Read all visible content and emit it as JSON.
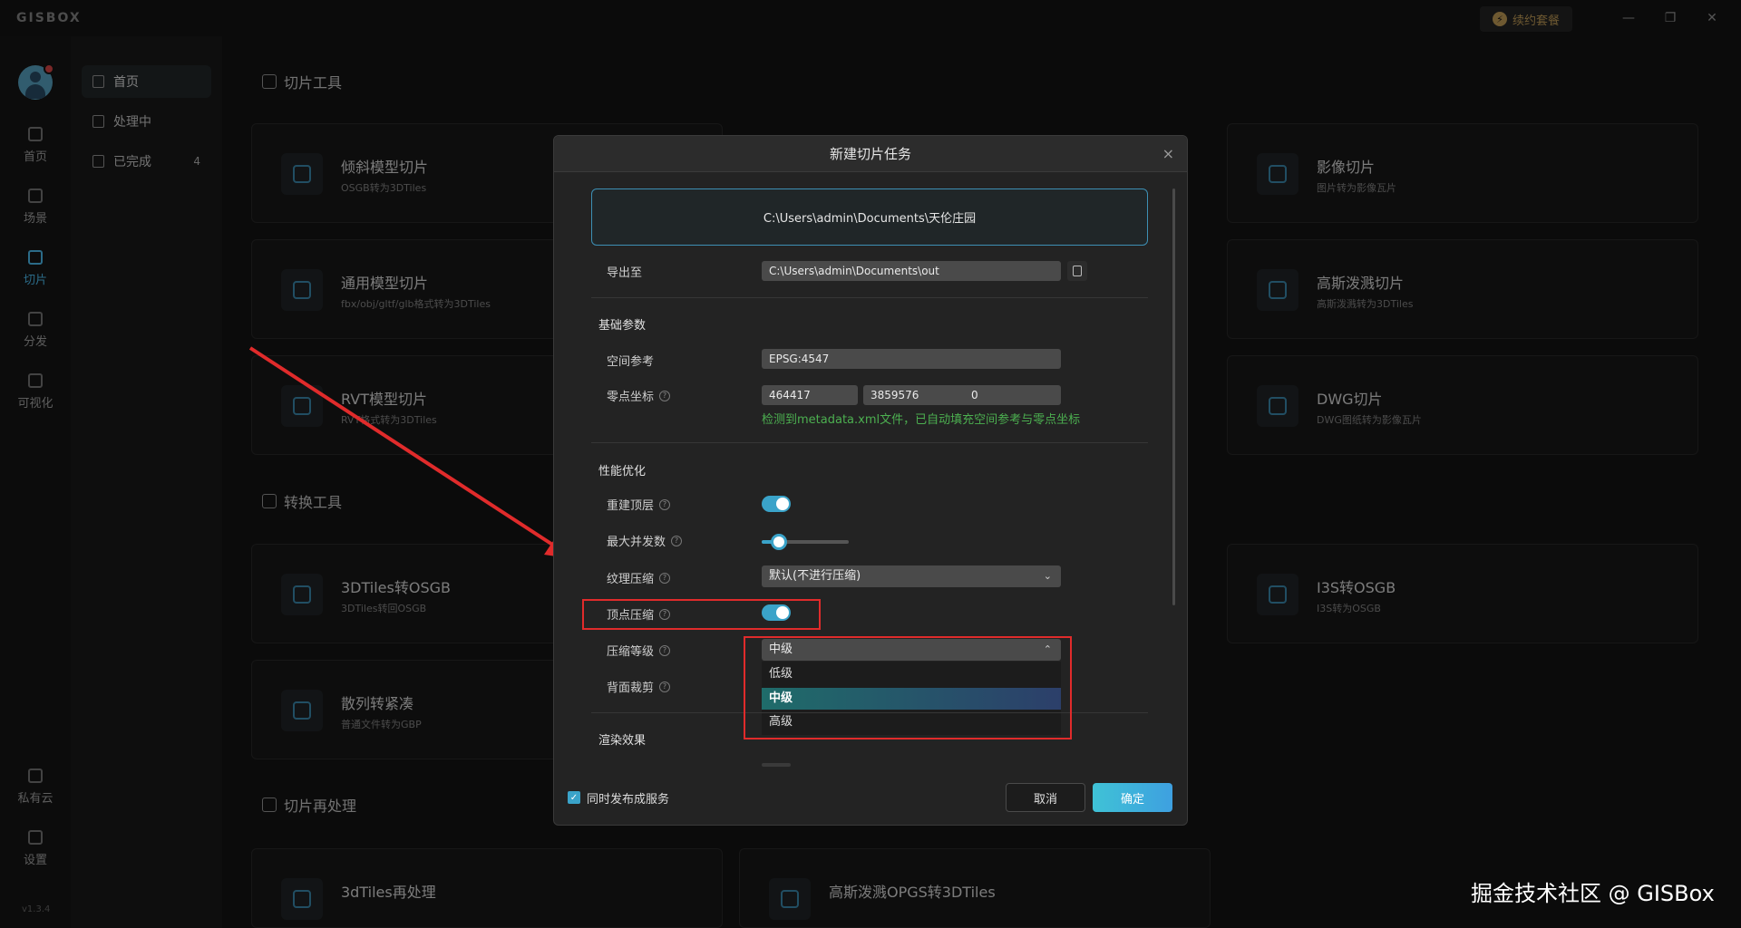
{
  "app": {
    "brand": "GISBOX",
    "version": "v1.3.4",
    "renew_label": "续约套餐"
  },
  "window": {
    "minimize": "—",
    "restore": "❐",
    "close": "✕"
  },
  "rail": {
    "items": [
      {
        "label": "首页",
        "icon": "home-icon"
      },
      {
        "label": "场景",
        "icon": "scene-icon"
      },
      {
        "label": "切片",
        "icon": "slice-icon",
        "active": true
      },
      {
        "label": "分发",
        "icon": "distribute-icon"
      },
      {
        "label": "可视化",
        "icon": "visualize-icon"
      },
      {
        "label": "私有云",
        "icon": "lock-icon"
      },
      {
        "label": "设置",
        "icon": "gear-icon"
      }
    ]
  },
  "nav": {
    "items": [
      {
        "label": "首页",
        "count": ""
      },
      {
        "label": "处理中",
        "count": ""
      },
      {
        "label": "已完成",
        "count": "4"
      }
    ]
  },
  "sections": {
    "slice_tools": "切片工具",
    "convert_tools": "转换工具",
    "reprocess": "切片再处理"
  },
  "cards": [
    {
      "title": "倾斜模型切片",
      "sub": "OSGB转为3DTiles"
    },
    {
      "title": "影像切片",
      "sub": "图片转为影像瓦片"
    },
    {
      "title": "通用模型切片",
      "sub": "fbx/obj/gltf/glb格式转为3DTiles"
    },
    {
      "title": "高斯泼溅切片",
      "sub": "高斯泼溅转为3DTiles"
    },
    {
      "title": "RVT模型切片",
      "sub": "RVT格式转为3DTiles"
    },
    {
      "title": "DWG切片",
      "sub": "DWG图纸转为影像瓦片"
    },
    {
      "title": "3DTiles转OSGB",
      "sub": "3DTiles转回OSGB"
    },
    {
      "title": "I3S转OSGB",
      "sub": "I3S转为OSGB"
    },
    {
      "title": "散列转紧凑",
      "sub": "普通文件转为GBP"
    },
    {
      "title": "3dTiles再处理",
      "sub": ""
    },
    {
      "title": "高斯泼溅OPGS转3DTiles",
      "sub": ""
    }
  ],
  "dialog": {
    "title": "新建切片任务",
    "close": "×",
    "source_path": "C:\\Users\\admin\\Documents\\天伦庄园",
    "export_label": "导出至",
    "export_path": "C:\\Users\\admin\\Documents\\out",
    "basic_group": "基础参数",
    "spatial_ref_label": "空间参考",
    "spatial_ref_value": "EPSG:4547",
    "origin_label": "零点坐标",
    "origin_x": "464417",
    "origin_y": "3859576",
    "origin_z": "0",
    "hint": "检测到metadata.xml文件，已自动填充空间参考与零点坐标",
    "perf_group": "性能优化",
    "rebuild_top_label": "重建顶层",
    "rebuild_top_on": true,
    "max_concurrency_label": "最大并发数",
    "max_concurrency_fraction": 0.2,
    "texture_compress_label": "纹理压缩",
    "texture_compress_value": "默认(不进行压缩)",
    "vertex_compress_label": "顶点压缩",
    "vertex_compress_on": true,
    "compress_level_label": "压缩等级",
    "compress_level_value": "中级",
    "compress_level_options": [
      "低级",
      "中级",
      "高级"
    ],
    "backface_cull_label": "背面裁剪",
    "render_group": "渲染效果",
    "publish_label": "同时发布成服务",
    "publish_checked": true,
    "cancel": "取消",
    "ok": "确定"
  },
  "watermark": "掘金技术社区 @ GISBox",
  "colors": {
    "accent": "#3aa3c9",
    "annotation": "#e02b2b",
    "hint": "#4caf50"
  }
}
